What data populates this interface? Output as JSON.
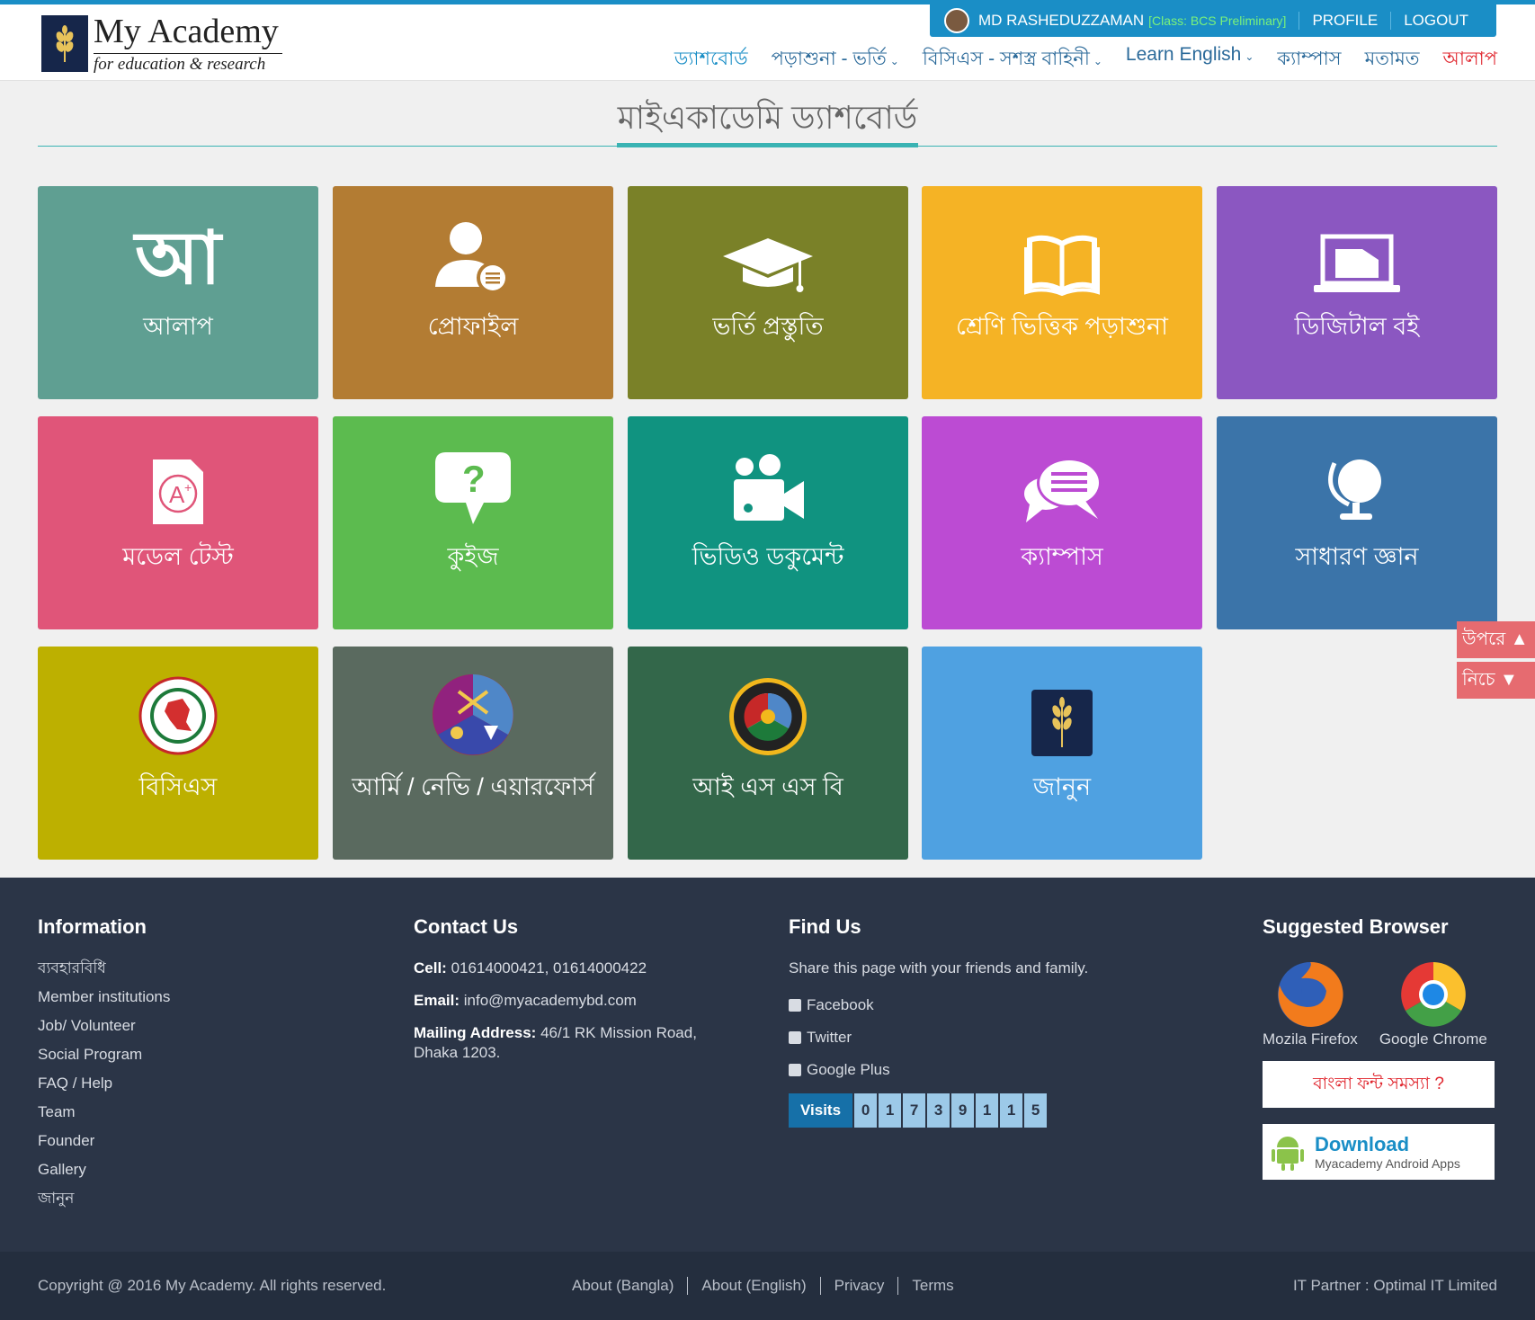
{
  "brand": {
    "title": "My Academy",
    "subtitle": "for education & research"
  },
  "userbar": {
    "name": "MD RASHEDUZZAMAN",
    "class_label": "[Class: BCS Preliminary]",
    "profile": "PROFILE",
    "logout": "LOGOUT"
  },
  "nav": {
    "dashboard": "ড্যাশবোর্ড",
    "study": "পড়াশুনা - ভর্তি",
    "bcs": "বিসিএস - সশস্ত্র বাহিনী",
    "english": "Learn English",
    "campus": "ক্যাম্পাস",
    "opinion": "মতামত",
    "alap": "আলাপ"
  },
  "page_title": "মাইএকাডেমি ড্যাশবোর্ড",
  "tiles": [
    {
      "label": "আলাপ",
      "glyph": "আ",
      "icon": "alap-letter-icon",
      "color": "#5f9f92"
    },
    {
      "label": "প্রোফাইল",
      "icon": "profile-icon",
      "color": "#b37c33"
    },
    {
      "label": "ভর্তি প্রস্তুতি",
      "icon": "graduation-cap-icon",
      "color": "#7a8128"
    },
    {
      "label": "শ্রেণি ভিত্তিক পড়াশুনা",
      "icon": "book-icon",
      "color": "#f5b325"
    },
    {
      "label": "ডিজিটাল বই",
      "icon": "laptop-icon",
      "color": "#8b57c1"
    },
    {
      "label": "মডেল টেস্ট",
      "icon": "grade-paper-icon",
      "color": "#e05579"
    },
    {
      "label": "কুইজ",
      "icon": "question-bubble-icon",
      "color": "#5cbb4f"
    },
    {
      "label": "ভিডিও ডকুমেন্ট",
      "icon": "video-camera-icon",
      "color": "#109380"
    },
    {
      "label": "ক্যাম্পাস",
      "icon": "chat-bubbles-icon",
      "color": "#bc4bd3"
    },
    {
      "label": "সাধারণ জ্ঞান",
      "icon": "globe-icon",
      "color": "#3b74a9"
    },
    {
      "label": "বিসিএস",
      "icon": "bangladesh-govt-seal-icon",
      "color": "#bdb000"
    },
    {
      "label": "আর্মি / নেভি / এয়ারফোর্স",
      "icon": "armed-forces-emblem-icon",
      "color": "#5a6a5f"
    },
    {
      "label": "আই এস এস বি",
      "icon": "issb-emblem-icon",
      "color": "#33674a"
    },
    {
      "label": "জানুন",
      "icon": "myacademy-logo-icon",
      "color": "#4fa1e1"
    }
  ],
  "scroll": {
    "up": "উপরে ▲",
    "down": "নিচে ▼"
  },
  "footer": {
    "information": {
      "title": "Information",
      "links": [
        "ব্যবহারবিধি",
        "Member institutions",
        "Job/ Volunteer",
        "Social Program",
        "FAQ / Help",
        "Team",
        "Founder",
        "Gallery",
        "জানুন"
      ]
    },
    "contact": {
      "title": "Contact Us",
      "cell_label": "Cell:",
      "cell": "01614000421, 01614000422",
      "email_label": "Email:",
      "email": "info@myacademybd.com",
      "address_label": "Mailing Address:",
      "address_1": "46/1 RK Mission Road,",
      "address_2": "Dhaka 1203."
    },
    "find": {
      "title": "Find Us",
      "share": "Share this page with your friends and family.",
      "facebook": "Facebook",
      "twitter": "Twitter",
      "google": "Google Plus",
      "visits_label": "Visits",
      "visits_digits": [
        "0",
        "1",
        "7",
        "3",
        "9",
        "1",
        "1",
        "5"
      ]
    },
    "browser": {
      "title": "Suggested Browser",
      "firefox": "Mozila Firefox",
      "chrome": "Google Chrome",
      "font_problem": "বাংলা ফন্ট সমস্যা ?",
      "download": "Download",
      "download_sub": "Myacademy Android Apps"
    }
  },
  "bottom": {
    "copyright": "Copyright @ 2016 My Academy. All rights reserved.",
    "links": [
      "About (Bangla)",
      "About (English)",
      "Privacy",
      "Terms"
    ],
    "partner": "IT Partner : Optimal IT Limited"
  }
}
